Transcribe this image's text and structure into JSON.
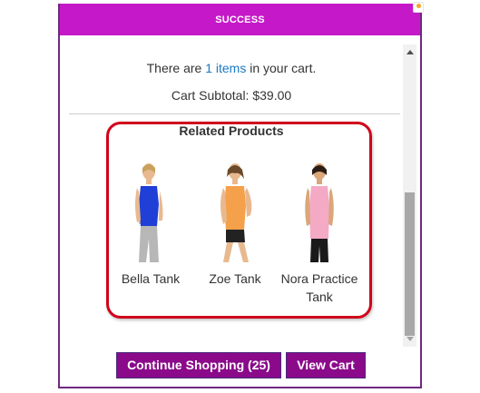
{
  "popup": {
    "title": "SUCCESS",
    "cart_prefix": "There are ",
    "cart_link": "1 items",
    "cart_suffix": " in your cart.",
    "subtotal": "Cart Subtotal: $39.00"
  },
  "related": {
    "title": "Related Products",
    "products": [
      {
        "name": "Bella Tank",
        "color": "#1f3fd6",
        "image": "woman-blue-tank"
      },
      {
        "name": "Zoe Tank",
        "color": "#f5a04a",
        "image": "woman-orange-tank"
      },
      {
        "name": "Nora Practice Tank",
        "color": "#f4aac4",
        "image": "woman-pink-tank"
      }
    ]
  },
  "buttons": {
    "continue": "Continue Shopping (25)",
    "view_cart": "View Cart"
  },
  "colors": {
    "header": "#c518c8",
    "button": "#8a0a8a",
    "highlight": "#d0021b",
    "link": "#1979c3"
  }
}
